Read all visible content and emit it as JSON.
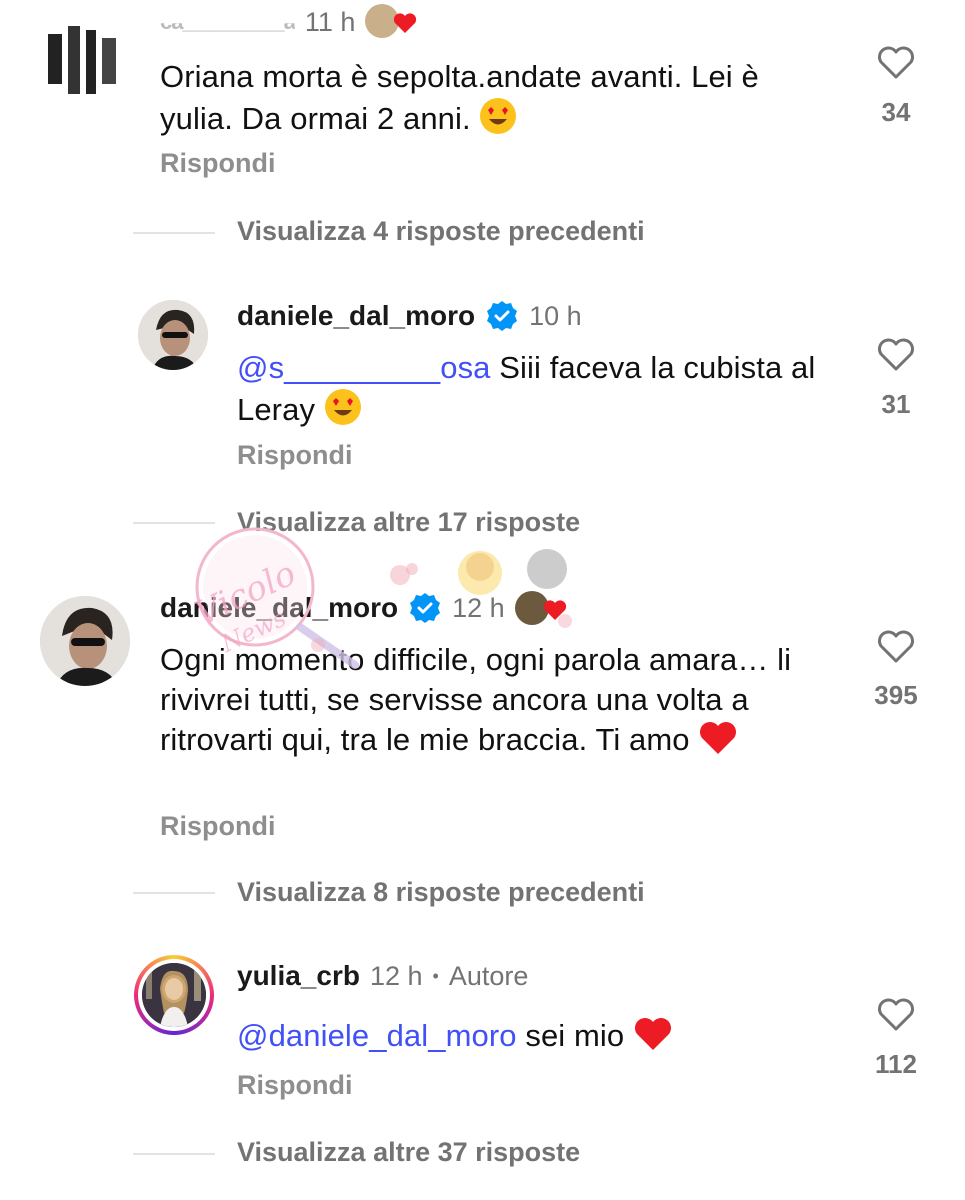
{
  "comments": [
    {
      "username": "ca_________a",
      "time": "11 h",
      "text": "Oriana morta è sepolta.andate avanti. Lei è yulia. Da ormai 2 anni.",
      "emoji": "heart-eyes",
      "reply": "Rispondi",
      "likes": "34"
    },
    {
      "username": "daniele_dal_moro",
      "time": "10 h",
      "mention": "@s_________osa",
      "text": "Siii faceva la cubista al Leray",
      "emoji": "heart-eyes",
      "reply": "Rispondi",
      "likes": "31",
      "verified": true
    },
    {
      "username": "daniele_dal_moro",
      "time": "12 h",
      "text": "Ogni momento difficile, ogni parola amara… li rivivrei tutti, se servisse ancora una volta a ritrovarti qui, tra le mie braccia. Ti amo",
      "emoji": "red-heart",
      "reply": "Rispondi",
      "likes": "395",
      "verified": true
    },
    {
      "username": "yulia_crb",
      "time": "12 h",
      "badge": "Autore",
      "mention": "@daniele_dal_moro",
      "text": "sei mio",
      "emoji": "red-heart",
      "reply": "Rispondi",
      "likes": "112"
    }
  ],
  "view_links": {
    "first": "Visualizza 4 risposte precedenti",
    "second": "Visualizza altre 17 risposte",
    "third": "Visualizza 8 risposte precedenti",
    "fourth": "Visualizza altre 37 risposte"
  },
  "watermark_text": "Vicolo delle News",
  "colors": {
    "mention": "#4150f7",
    "verified": "#0095f6",
    "heart": "#ed1b24",
    "muted": "#737373"
  }
}
